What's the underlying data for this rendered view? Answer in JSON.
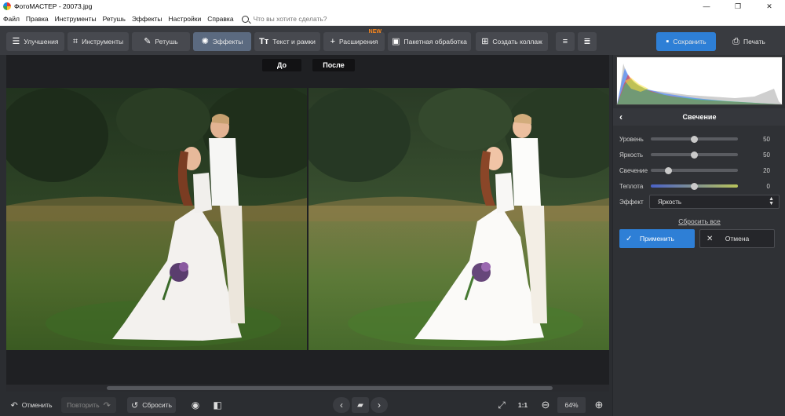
{
  "window": {
    "title": "ФотоМАСТЕР - 20073.jpg",
    "controls": [
      "—",
      "❐",
      "✕"
    ]
  },
  "menu": {
    "items": [
      "Файл",
      "Правка",
      "Инструменты",
      "Ретушь",
      "Эффекты",
      "Настройки",
      "Справка"
    ],
    "search_placeholder": "Что вы хотите сделать?"
  },
  "toolbar": {
    "tabs": [
      {
        "label": "Улучшения",
        "icon": "sliders-icon"
      },
      {
        "label": "Инструменты",
        "icon": "crop-icon"
      },
      {
        "label": "Ретушь",
        "icon": "brush-icon"
      },
      {
        "label": "Эффекты",
        "icon": "sparkle-icon",
        "active": true
      },
      {
        "label": "Текст и рамки",
        "icon": "text-icon"
      },
      {
        "label": "Расширения",
        "icon": "plus-icon",
        "badge": "NEW"
      },
      {
        "label": "Пакетная обработка",
        "icon": "image-icon"
      },
      {
        "label": "Создать коллаж",
        "icon": "collage-icon"
      }
    ],
    "save_label": "Сохранить",
    "print_label": "Печать"
  },
  "canvas": {
    "before_label": "До",
    "after_label": "После"
  },
  "bottom": {
    "undo_label": "Отменить",
    "redo_label": "Повторить",
    "reset_label": "Сбросить",
    "zoom_ratio_label": "1:1",
    "zoom_value": "64%"
  },
  "panel": {
    "title": "Свечение",
    "sliders": [
      {
        "label": "Уровень",
        "value": "50",
        "fraction": 0.5
      },
      {
        "label": "Яркость",
        "value": "50",
        "fraction": 0.5
      },
      {
        "label": "Свечение",
        "value": "20",
        "fraction": 0.2
      },
      {
        "label": "Теплота",
        "value": "0",
        "fraction": 0.5
      }
    ],
    "effect_label": "Эффект",
    "effect_value": "Яркость",
    "reset_all_label": "Сбросить все",
    "apply_label": "Применить",
    "cancel_label": "Отмена"
  },
  "colors": {
    "accent": "#2e7fd6",
    "new_badge": "#ff8a1e"
  }
}
